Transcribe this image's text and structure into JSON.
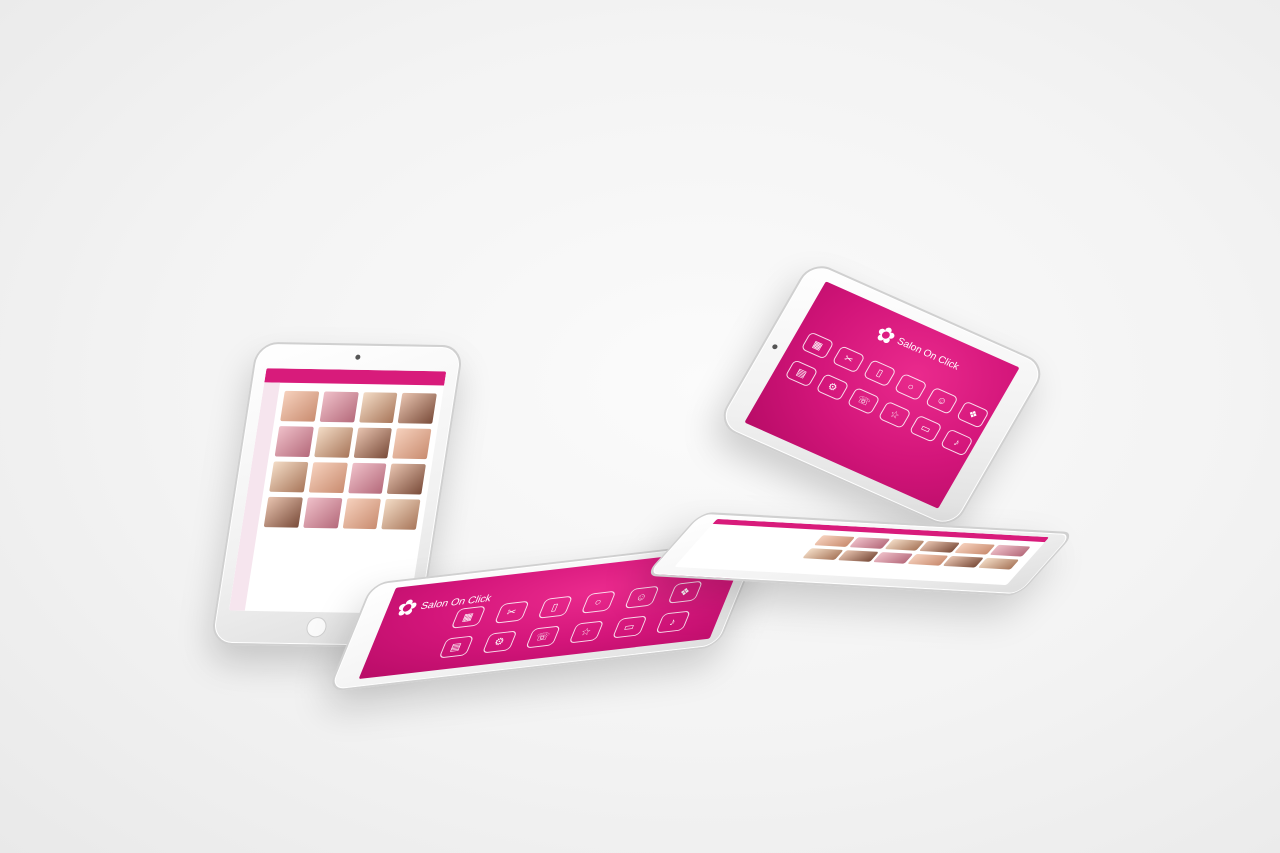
{
  "brand": {
    "name": "Salon On Click",
    "logo_icon": "orchid-flower-icon"
  },
  "colors": {
    "accent": "#d81b7b",
    "background": "#f3f3f3",
    "device": "#ffffff"
  },
  "devices": [
    {
      "id": "catalog-tablet",
      "screen": "product-catalog",
      "icon": "photo-grid-icon"
    },
    {
      "id": "menu-tablet-flat",
      "screen": "main-menu",
      "icon": "app-menu-icon"
    },
    {
      "id": "menu-tablet-tilted",
      "screen": "main-menu",
      "icon": "app-menu-icon"
    },
    {
      "id": "catalog-tablet-flat",
      "screen": "product-catalog",
      "icon": "photo-grid-icon"
    }
  ],
  "menu_icons": [
    "calendar-icon",
    "scissors-icon",
    "bottle-icon",
    "mirror-icon",
    "user-icon",
    "gift-icon",
    "chart-icon",
    "settings-icon",
    "phone-icon",
    "star-icon",
    "cart-icon",
    "bell-icon"
  ]
}
